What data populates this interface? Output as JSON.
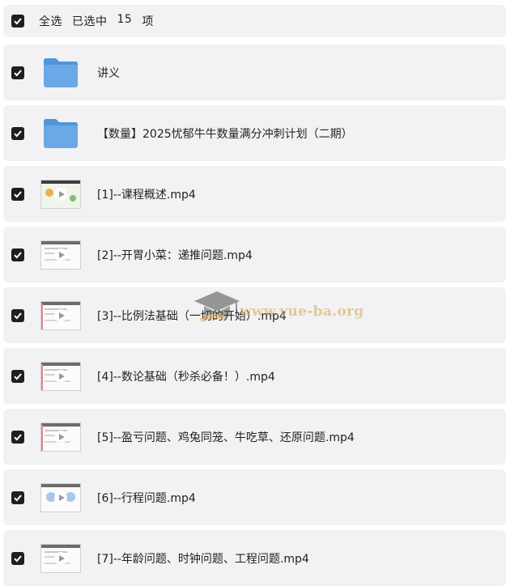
{
  "header": {
    "select_all_label": "全选",
    "selected_prefix": "已选中",
    "selected_count": "15",
    "selected_suffix": "项"
  },
  "files": [
    {
      "name": "讲义",
      "type": "folder"
    },
    {
      "name": "【数量】2025忧郁牛牛数量满分冲刺计划（二期）",
      "type": "folder"
    },
    {
      "name": "[1]--课程概述.mp4",
      "type": "video",
      "thumb": "colorful"
    },
    {
      "name": "[2]--开胃小菜：递推问题.mp4",
      "type": "video",
      "thumb": "plain"
    },
    {
      "name": "[3]--比例法基础（一切的开始）.mp4",
      "type": "video",
      "thumb": "plain"
    },
    {
      "name": "[4]--数论基础（秒杀必备！）.mp4",
      "type": "video",
      "thumb": "plain"
    },
    {
      "name": "[5]--盈亏问题、鸡兔同笼、牛吃草、还原问题.mp4",
      "type": "video",
      "thumb": "plain"
    },
    {
      "name": "[6]--行程问题.mp4",
      "type": "video",
      "thumb": "blue"
    },
    {
      "name": "[7]--年龄问题、时钟问题、工程问题.mp4",
      "type": "video",
      "thumb": "plain"
    }
  ],
  "watermark": {
    "text": "www.yue-ba.org",
    "icon": "graduation-cap-icon"
  },
  "colors": {
    "row_background": "#f2f2f4",
    "checkbox_fill": "#1f1f1f",
    "folder_blue": "#6aa9e6"
  }
}
